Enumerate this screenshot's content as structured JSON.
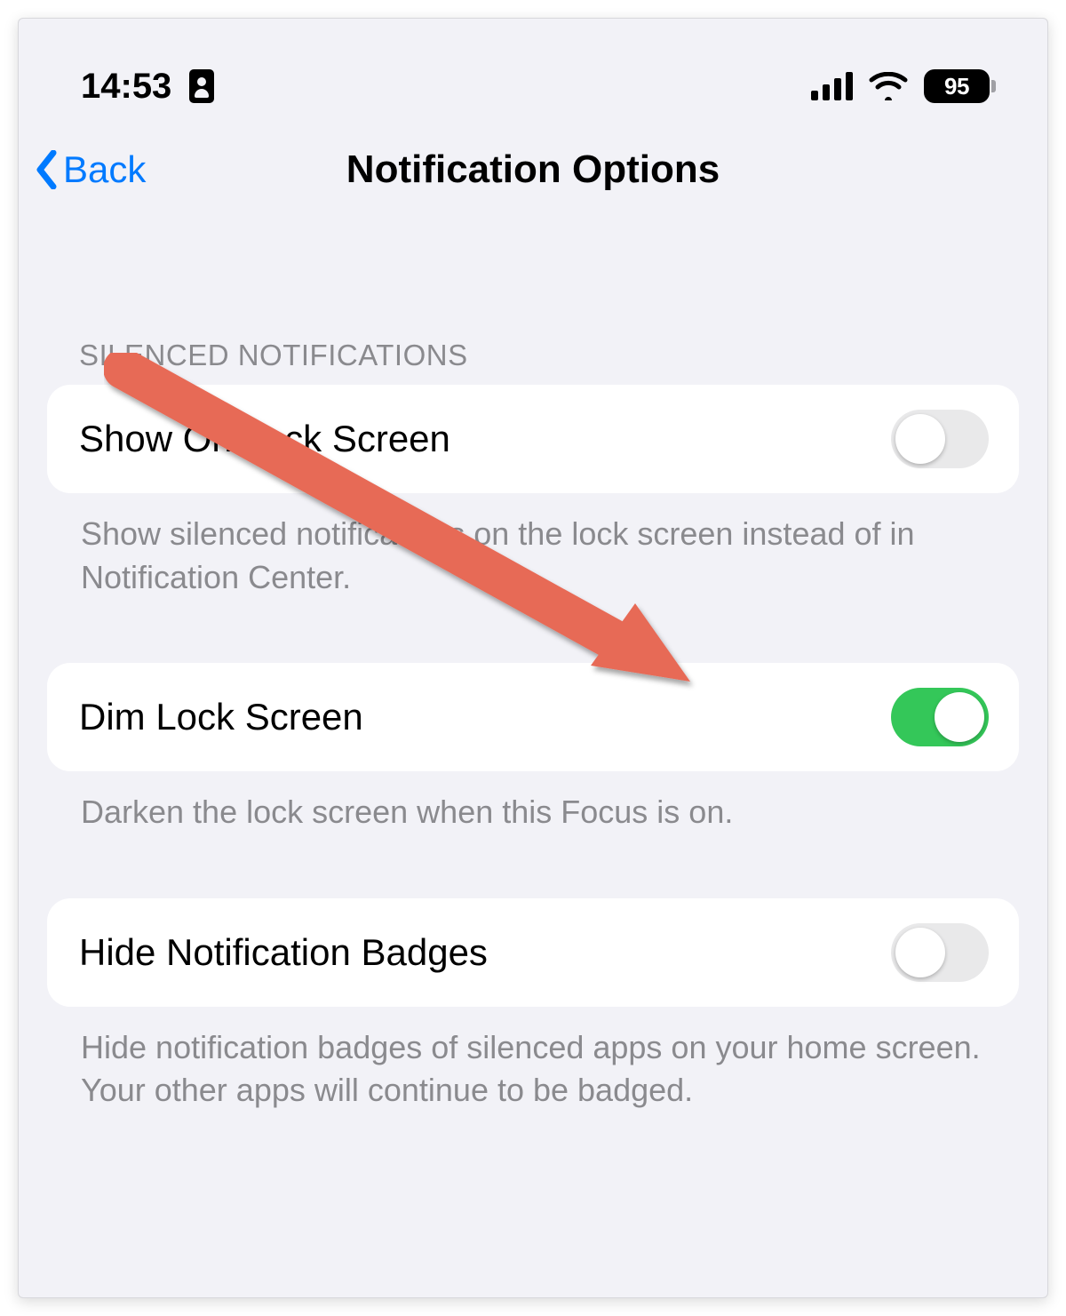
{
  "status": {
    "time": "14:53",
    "battery": "95"
  },
  "nav": {
    "back_label": "Back",
    "title": "Notification Options"
  },
  "section_header": "SILENCED NOTIFICATIONS",
  "rows": {
    "show_on_lock": {
      "label": "Show On Lock Screen",
      "footer": "Show silenced notifications on the lock screen instead of in Notification Center.",
      "on": false
    },
    "dim_lock": {
      "label": "Dim Lock Screen",
      "footer": "Darken the lock screen when this Focus is on.",
      "on": true
    },
    "hide_badges": {
      "label": "Hide Notification Badges",
      "footer": "Hide notification badges of silenced apps on your home screen. Your other apps will continue to be badged.",
      "on": false
    }
  },
  "colors": {
    "accent": "#007aff",
    "toggle_on": "#34c759",
    "annotation": "#e76a57"
  }
}
